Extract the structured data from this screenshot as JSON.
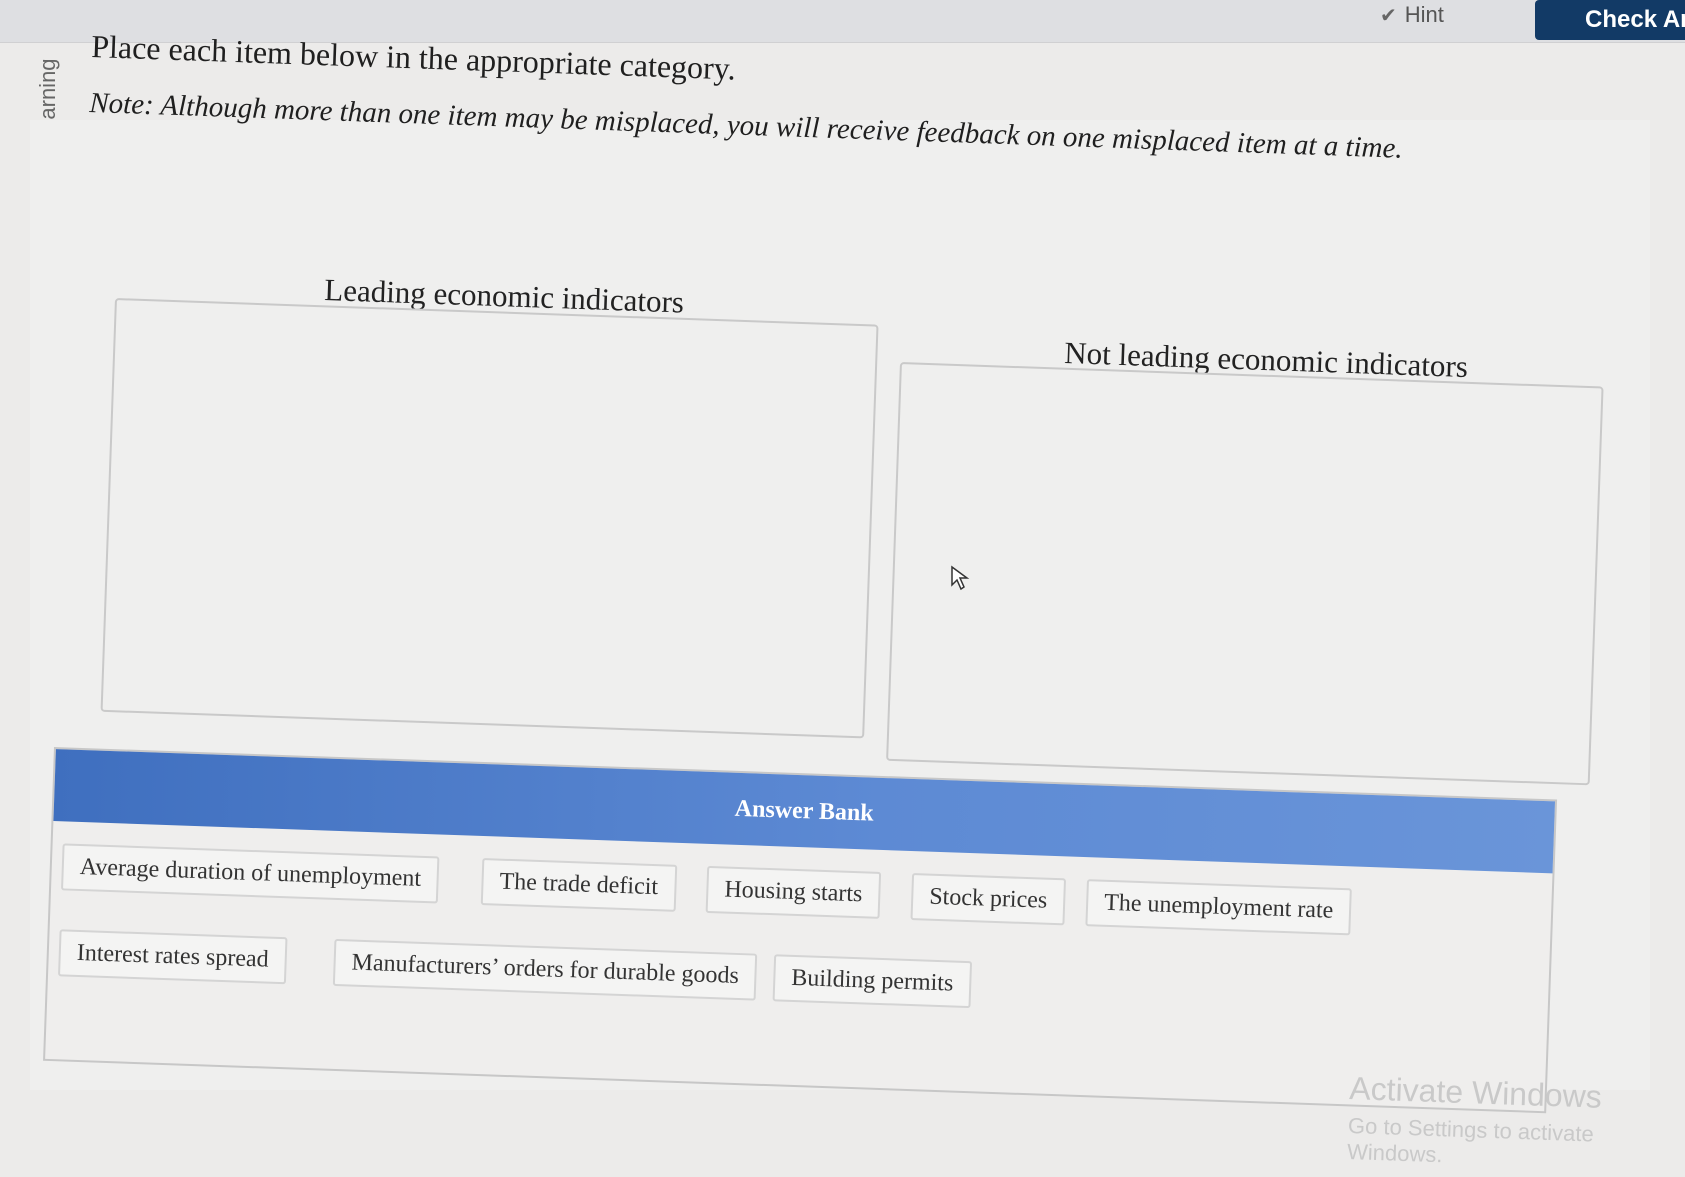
{
  "toolbar": {
    "hint_label": "Hint",
    "check_label": "Check Ans"
  },
  "branding": "© Macmillan Learning",
  "instructions": {
    "main": "Place each item below in the appropriate category.",
    "note": "Note: Although more than one item may be misplaced, you will receive feedback on one misplaced item at a time."
  },
  "categories": [
    {
      "label": "Leading economic indicators"
    },
    {
      "label": "Not leading economic indicators"
    }
  ],
  "answer_bank": {
    "title": "Answer Bank",
    "items": [
      "Average duration of unemployment",
      "The trade deficit",
      "Housing starts",
      "Stock prices",
      "The unemployment rate",
      "Interest rates spread",
      "Manufacturers’ orders for durable goods",
      "Building permits"
    ]
  },
  "watermark": {
    "title": "Activate Windows",
    "subtitle": "Go to Settings to activate Windows."
  },
  "colors": {
    "bank_header": "#4f7fcb",
    "check_button": "#123a66"
  }
}
